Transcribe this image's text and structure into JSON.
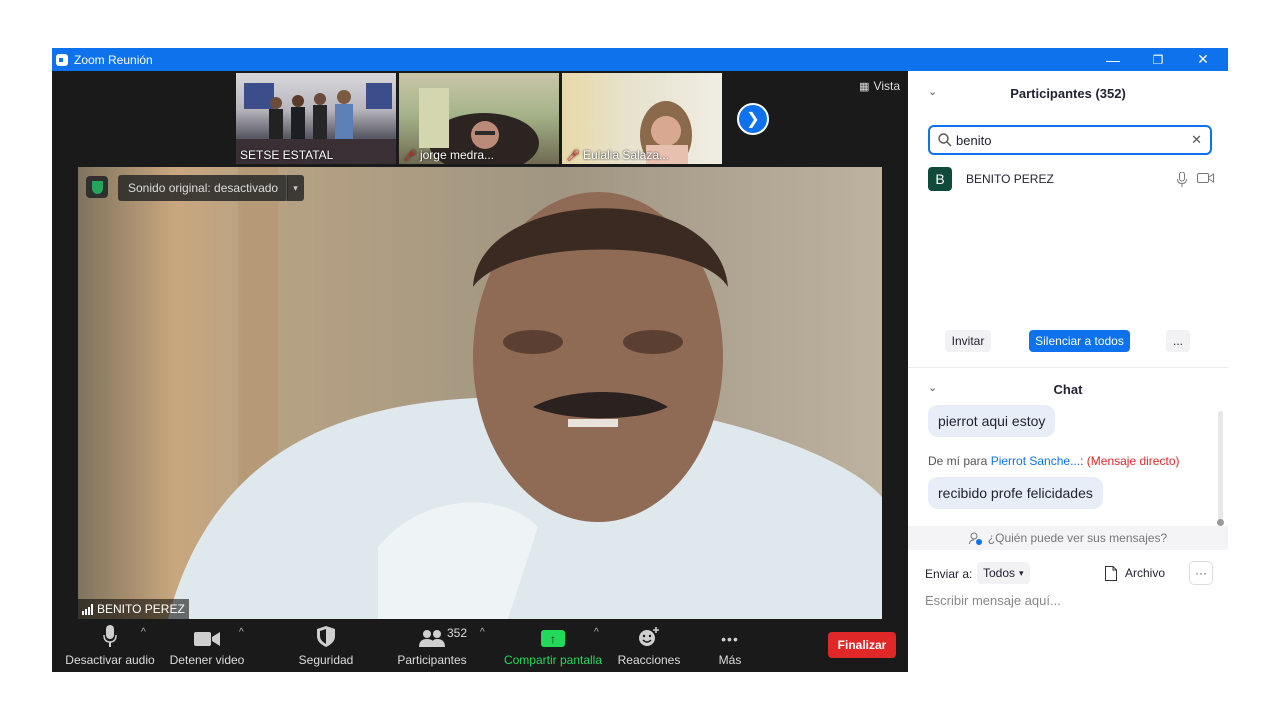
{
  "window": {
    "title": "Zoom Reunión",
    "controls": {
      "minimize": "—",
      "restore": "❐",
      "close": "✕"
    }
  },
  "gallery": {
    "thumbnails": [
      {
        "name": "SETSE ESTATAL",
        "muted": false
      },
      {
        "name": "jorge medra...",
        "muted": true
      },
      {
        "name": "Eulalia Salaza...",
        "muted": true
      }
    ],
    "next_icon": "chevron-right-icon",
    "view_label": "Vista"
  },
  "main_video": {
    "participant_name": "BENITO PEREZ",
    "sound_label": "Sonido original: desactivado",
    "sound_caret": "▾"
  },
  "toolbar": {
    "mute_label": "Desactivar audio",
    "video_label": "Detener video",
    "security_label": "Seguridad",
    "participants_label": "Participantes",
    "participants_count": "352",
    "share_label": "Compartir pantalla",
    "reactions_label": "Reacciones",
    "more_label": "Más",
    "more_icon": "•••",
    "end_label": "Finalizar",
    "caret": "^",
    "colors": {
      "share": "#23d959",
      "end": "#e02828"
    }
  },
  "participants_panel": {
    "title": "Participantes (352)",
    "collapse_icon": "⌄",
    "search_value": "benito",
    "search_clear": "✕",
    "results": [
      {
        "initial": "B",
        "name": "BENITO PEREZ"
      }
    ],
    "invite_label": "Invitar",
    "mute_all_label": "Silenciar a todos",
    "more_label": "..."
  },
  "chat": {
    "title": "Chat",
    "messages": [
      {
        "text": "pierrot aqui estoy"
      },
      {
        "from_label": "De mí para",
        "to": "Pierrot Sanche...",
        "colon": ":",
        "type": "(Mensaje directo)",
        "text": "recibido profe felicidades"
      }
    ],
    "who_can_see": "¿Quién puede ver sus mensajes?",
    "send_to_label": "Enviar a:",
    "send_to_value": "Todos",
    "file_label": "Archivo",
    "more_label": "···",
    "input_placeholder": "Escribir mensaje aquí..."
  },
  "colors": {
    "accent": "#0e72ed",
    "danger": "#e02828"
  }
}
